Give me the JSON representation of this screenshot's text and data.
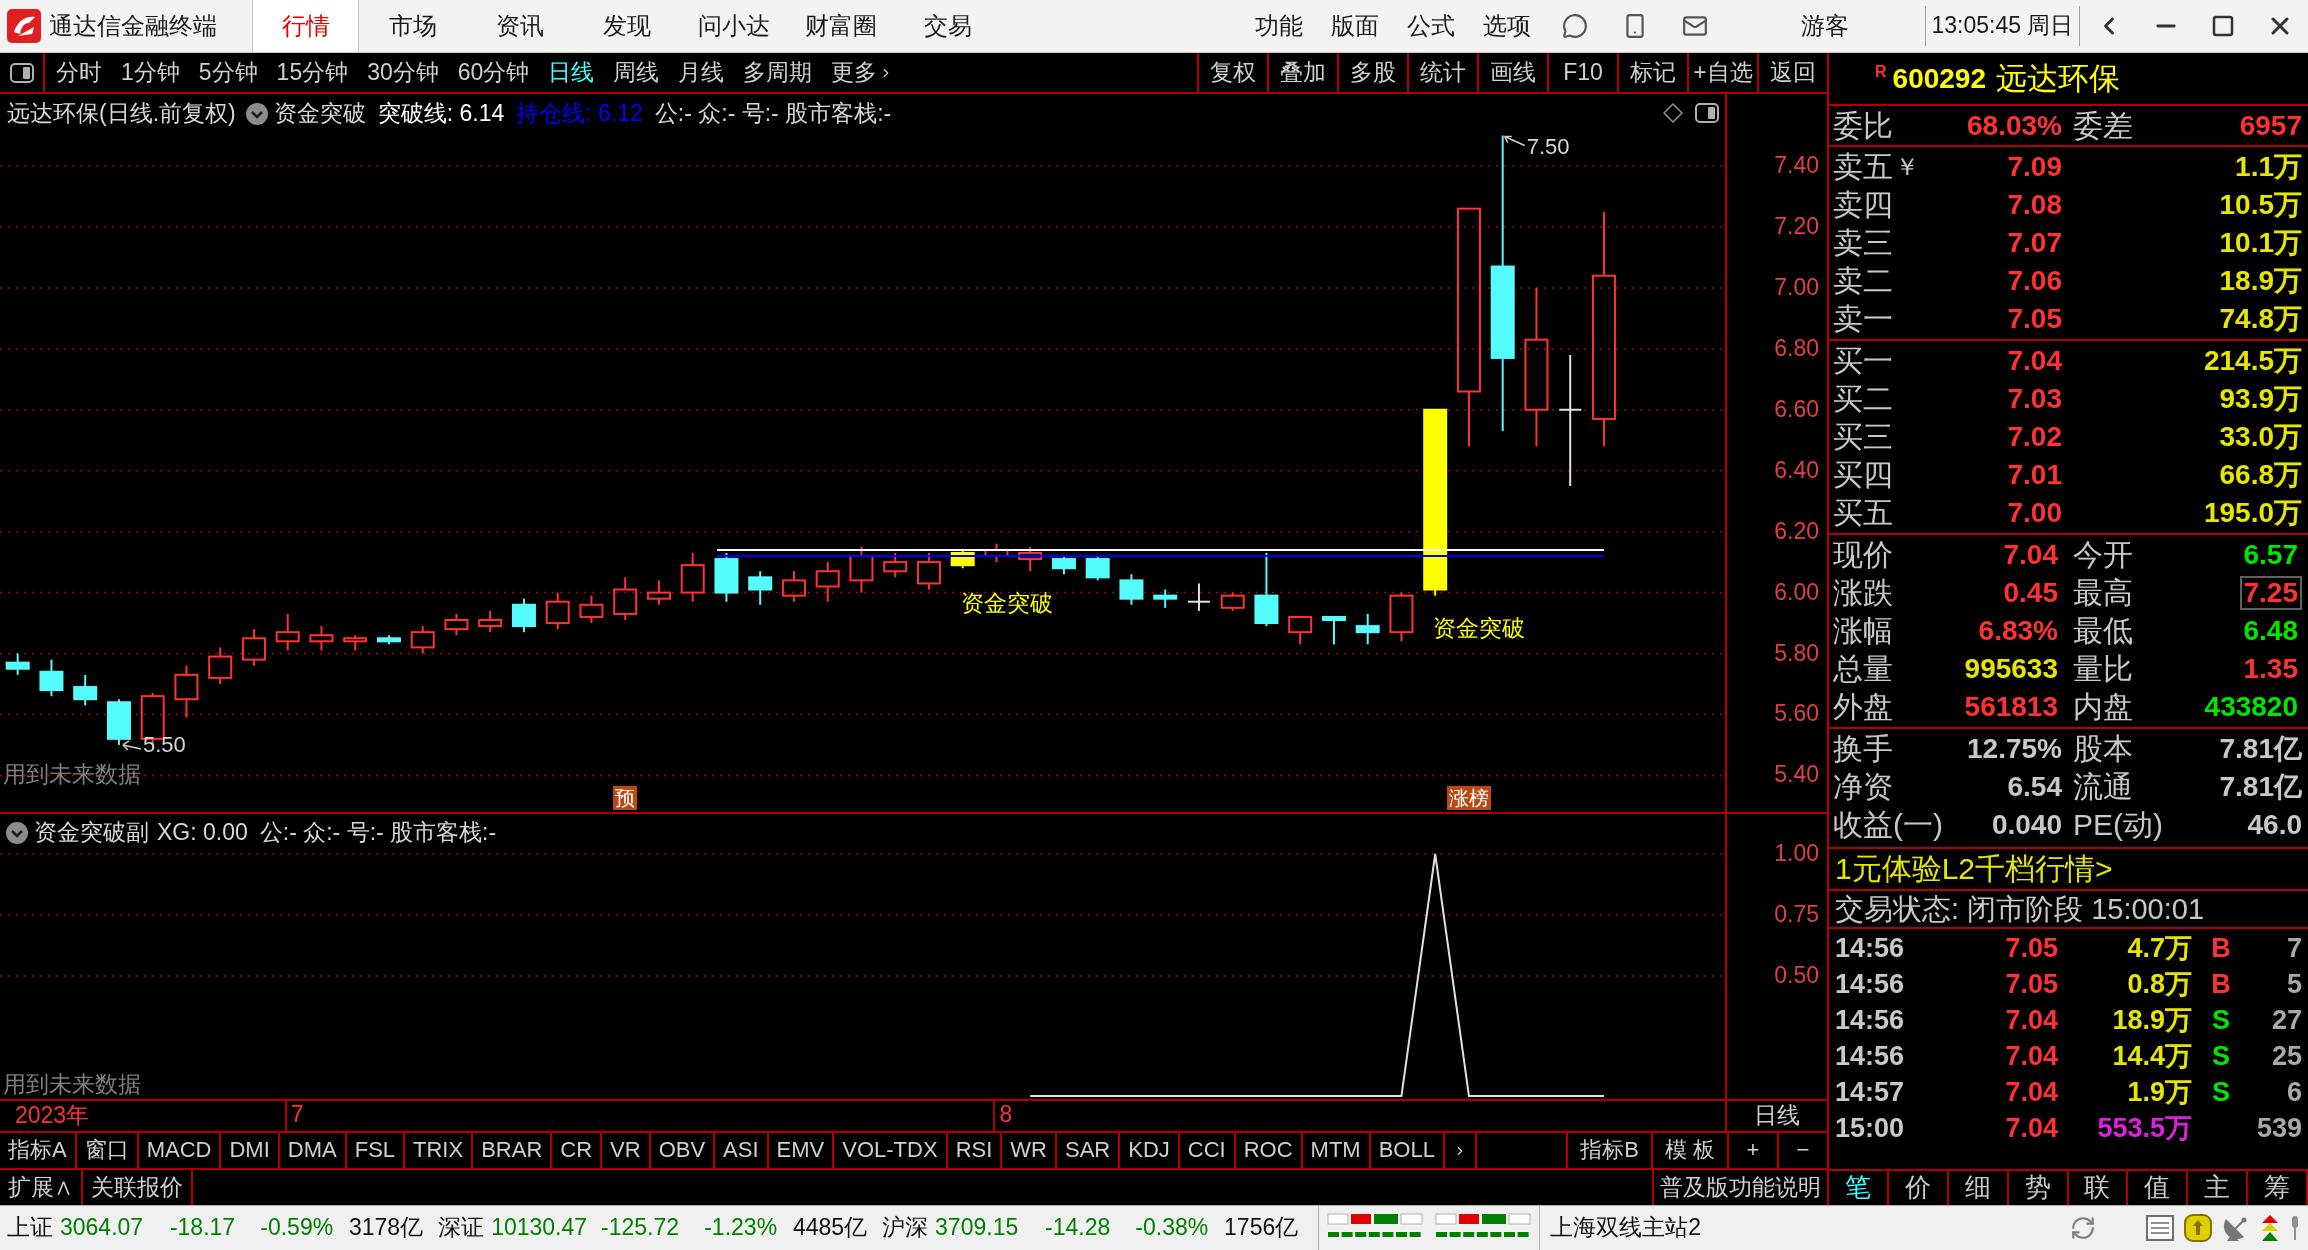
{
  "title_bar": {
    "app_name": "通达信金融终端",
    "tabs": [
      {
        "label": "行情",
        "selected": true
      },
      {
        "label": "市场",
        "selected": false
      },
      {
        "label": "资讯",
        "selected": false
      },
      {
        "label": "发现",
        "selected": false
      },
      {
        "label": "问小达",
        "selected": false
      },
      {
        "label": "财富圈",
        "selected": false
      },
      {
        "label": "交易",
        "selected": false
      }
    ],
    "menus": [
      "功能",
      "版面",
      "公式",
      "选项"
    ],
    "user": "游客",
    "clock": "13:05:45 周日"
  },
  "toolbar": {
    "periods": [
      {
        "label": "分时",
        "selected": false
      },
      {
        "label": "1分钟",
        "selected": false
      },
      {
        "label": "5分钟",
        "selected": false
      },
      {
        "label": "15分钟",
        "selected": false
      },
      {
        "label": "30分钟",
        "selected": false
      },
      {
        "label": "60分钟",
        "selected": false
      },
      {
        "label": "日线",
        "selected": true
      },
      {
        "label": "周线",
        "selected": false
      },
      {
        "label": "月线",
        "selected": false
      },
      {
        "label": "多周期",
        "selected": false
      }
    ],
    "more": "更多",
    "buttons": [
      "复权",
      "叠加",
      "多股",
      "统计",
      "画线",
      "F10",
      "标记",
      "+自选",
      "返回"
    ]
  },
  "main_chart": {
    "stock": "远达环保(日线.前复权)",
    "indicator": "资金突破",
    "lines": [
      {
        "label": "突破线: 6.14",
        "color": "#ffffff"
      },
      {
        "label": "持仓线: 6.12",
        "color": "#0000ff"
      }
    ],
    "extras": "公:- 众:- 号:- 股市客栈:-",
    "price_axis": [
      "7.40",
      "7.20",
      "7.00",
      "6.80",
      "6.60",
      "6.40",
      "6.20",
      "6.00",
      "5.80",
      "5.60",
      "5.40"
    ],
    "high_label": "7.50",
    "low_label": "5.50",
    "signals": [
      "资金突破",
      "资金突破"
    ],
    "markers": [
      "预",
      "涨榜"
    ],
    "note": "用到未来数据"
  },
  "sub_chart": {
    "title": "资金突破副",
    "values": "XG: 0.00",
    "extras": "公:- 众:- 号:- 股市客栈:-",
    "axis": [
      "1.00",
      "0.75",
      "0.50"
    ],
    "note": "用到未来数据"
  },
  "date_axis": {
    "year": "2023年",
    "months": [
      "7",
      "8"
    ],
    "period": "日线"
  },
  "indicator_bar": {
    "tabs": [
      "指标A",
      "窗口",
      "MACD",
      "DMI",
      "DMA",
      "FSL",
      "TRIX",
      "BRAR",
      "CR",
      "VR",
      "OBV",
      "ASI",
      "EMV",
      "VOL-TDX",
      "RSI",
      "WR",
      "SAR",
      "KDJ",
      "CCI",
      "ROC",
      "MTM",
      "BOLL"
    ],
    "right": [
      "指标B",
      "模 板"
    ],
    "zoom": [
      "+",
      "−"
    ]
  },
  "bottom_bar": {
    "buttons": [
      "扩展∧",
      "关联报价"
    ],
    "help": "普及版功能说明"
  },
  "quote": {
    "badge": "R",
    "code": "600292",
    "name": "远达环保",
    "ratio": [
      {
        "label": "委比",
        "value": "68.03%"
      },
      {
        "label": "委差",
        "value": "6957"
      }
    ],
    "ask_mark": "￥",
    "asks": [
      {
        "label": "卖五",
        "price": "7.09",
        "volume": "1.1万"
      },
      {
        "label": "卖四",
        "price": "7.08",
        "volume": "10.5万"
      },
      {
        "label": "卖三",
        "price": "7.07",
        "volume": "10.1万"
      },
      {
        "label": "卖二",
        "price": "7.06",
        "volume": "18.9万"
      },
      {
        "label": "卖一",
        "price": "7.05",
        "volume": "74.8万"
      }
    ],
    "bids": [
      {
        "label": "买一",
        "price": "7.04",
        "volume": "214.5万"
      },
      {
        "label": "买二",
        "price": "7.03",
        "volume": "93.9万"
      },
      {
        "label": "买三",
        "price": "7.02",
        "volume": "33.0万"
      },
      {
        "label": "买四",
        "price": "7.01",
        "volume": "66.8万"
      },
      {
        "label": "买五",
        "price": "7.00",
        "volume": "195.0万"
      }
    ],
    "stats": [
      {
        "label": "现价",
        "value": "7.04",
        "color": "#ff3232",
        "boxed": false
      },
      {
        "label": "今开",
        "value": "6.57",
        "color": "#00e600",
        "boxed": false
      },
      {
        "label": "涨跌",
        "value": "0.45",
        "color": "#ff3232",
        "boxed": false
      },
      {
        "label": "最高",
        "value": "7.25",
        "color": "#ff3232",
        "boxed": true
      },
      {
        "label": "涨幅",
        "value": "6.83%",
        "color": "#ff3232",
        "boxed": false
      },
      {
        "label": "最低",
        "value": "6.48",
        "color": "#00e600",
        "boxed": false
      },
      {
        "label": "总量",
        "value": "995633",
        "color": "#e6e600",
        "boxed": false
      },
      {
        "label": "量比",
        "value": "1.35",
        "color": "#ff3232",
        "boxed": false
      },
      {
        "label": "外盘",
        "value": "561813",
        "color": "#ff3232",
        "boxed": false
      },
      {
        "label": "内盘",
        "value": "433820",
        "color": "#00e600",
        "boxed": false
      }
    ],
    "fundamentals": [
      {
        "label": "换手",
        "value": "12.75%"
      },
      {
        "label": "股本",
        "value": "7.81亿"
      },
      {
        "label": "净资",
        "value": "6.54"
      },
      {
        "label": "流通",
        "value": "7.81亿"
      },
      {
        "label": "收益(一)",
        "value": "0.040"
      },
      {
        "label": "PE(动)",
        "value": "46.0"
      }
    ],
    "promo": "1元体验L2千档行情>",
    "status": "交易状态: 闭市阶段 15:00:01",
    "trades": [
      {
        "time": "14:56",
        "price": "7.05",
        "volume": "4.7万",
        "side": "B",
        "count": "7",
        "kind": "buy"
      },
      {
        "time": "14:56",
        "price": "7.05",
        "volume": "0.8万",
        "side": "B",
        "count": "5",
        "kind": "buy"
      },
      {
        "time": "14:56",
        "price": "7.04",
        "volume": "18.9万",
        "side": "S",
        "count": "27",
        "kind": "sell"
      },
      {
        "time": "14:56",
        "price": "7.04",
        "volume": "14.4万",
        "side": "S",
        "count": "25",
        "kind": "sell"
      },
      {
        "time": "14:57",
        "price": "7.04",
        "volume": "1.9万",
        "side": "S",
        "count": "6",
        "kind": "sell"
      },
      {
        "time": "15:00",
        "price": "7.04",
        "volume": "553.5万",
        "count": "539",
        "kind": "auction"
      }
    ],
    "tabs": [
      {
        "label": "笔",
        "selected": true
      },
      {
        "label": "价",
        "selected": false
      },
      {
        "label": "细",
        "selected": false
      },
      {
        "label": "势",
        "selected": false
      },
      {
        "label": "联",
        "selected": false
      },
      {
        "label": "值",
        "selected": false
      },
      {
        "label": "主",
        "selected": false
      },
      {
        "label": "筹",
        "selected": false
      }
    ]
  },
  "status_bar": {
    "indices": [
      {
        "name": "上证",
        "value": "3064.07",
        "change": "-18.17",
        "percent": "-0.59%",
        "amount": "3178亿"
      },
      {
        "name": "深证",
        "value": "10130.47",
        "change": "-125.72",
        "percent": "-1.23%",
        "amount": "4485亿"
      },
      {
        "name": "沪深",
        "value": "3709.15",
        "change": "-14.28",
        "percent": "-0.38%",
        "amount": "1756亿"
      }
    ],
    "server": "上海双线主站2"
  }
}
